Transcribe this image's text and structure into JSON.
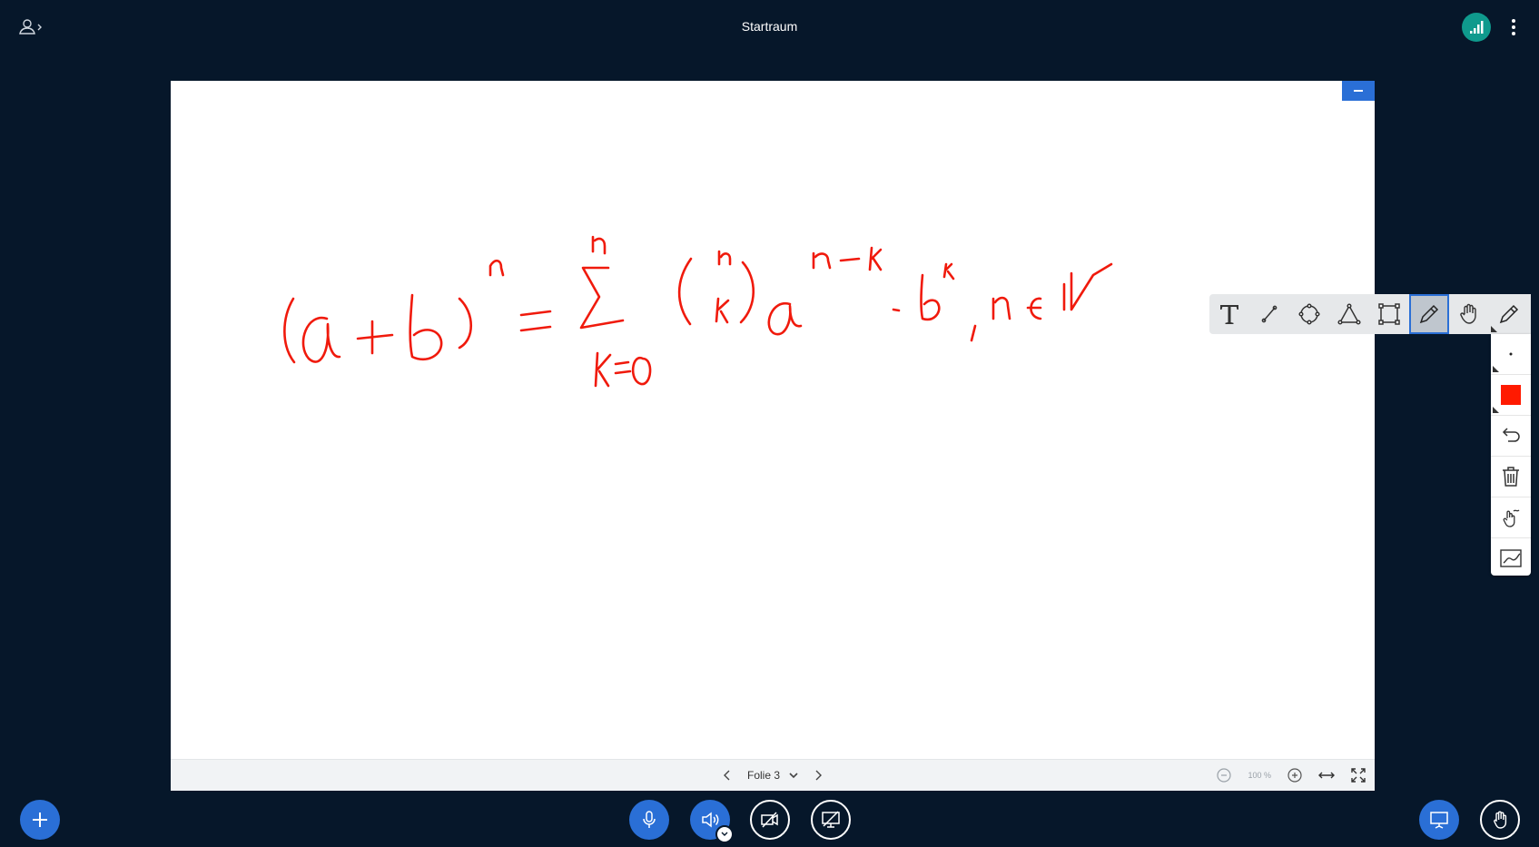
{
  "header": {
    "room_title": "Startraum",
    "user_list_icon": "user-list-toggle-icon",
    "connection_icon": "signal-bars-icon",
    "menu_icon": "vertical-dots-icon"
  },
  "presentation": {
    "ink_color": "#f01a0c",
    "slide_label": "Folie 3",
    "zoom_level": "100 %"
  },
  "toolbar": {
    "tools": [
      {
        "name": "text",
        "icon": "text-icon"
      },
      {
        "name": "line",
        "icon": "line-icon"
      },
      {
        "name": "ellipse",
        "icon": "ellipse-icon"
      },
      {
        "name": "triangle",
        "icon": "triangle-icon"
      },
      {
        "name": "rectangle",
        "icon": "rectangle-icon"
      },
      {
        "name": "pencil",
        "icon": "pencil-icon",
        "active": true
      },
      {
        "name": "pan",
        "icon": "hand-icon"
      },
      {
        "name": "pencil-menu",
        "icon": "pencil-icon"
      }
    ],
    "side": [
      {
        "name": "thickness",
        "icon": "dot-icon"
      },
      {
        "name": "color",
        "icon": "color-swatch",
        "color": "#ff1a00"
      },
      {
        "name": "undo",
        "icon": "undo-icon"
      },
      {
        "name": "clear",
        "icon": "trash-icon"
      },
      {
        "name": "multi-user",
        "icon": "multi-user-pen-icon"
      },
      {
        "name": "smooth",
        "icon": "smooth-line-icon"
      }
    ]
  },
  "colors": {
    "background": "#06172a",
    "primary": "#2a6fd6",
    "connection": "#0f9a8d"
  },
  "actions": {
    "add_icon": "plus-icon",
    "mic_icon": "microphone-icon",
    "audio_icon": "speaker-icon",
    "camera_icon": "video-off-icon",
    "screen_icon": "screen-share-off-icon",
    "presentation_icon": "presentation-icon",
    "raise_hand_icon": "raise-hand-icon"
  }
}
